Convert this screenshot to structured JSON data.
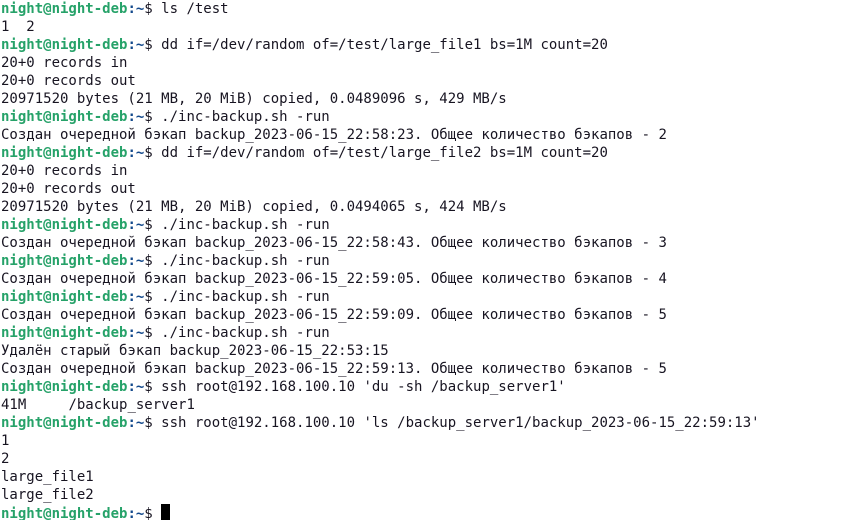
{
  "prompt": {
    "user_host": "night@night-deb",
    "path": ":~",
    "symbol": "$ "
  },
  "colors": {
    "user_host": "#26a269",
    "path": "#12488b",
    "text": "#171421",
    "background": "#ffffff"
  },
  "lines": [
    {
      "type": "cmd",
      "text": "ls /test"
    },
    {
      "type": "out",
      "text": "1  2"
    },
    {
      "type": "cmd",
      "text": "dd if=/dev/random of=/test/large_file1 bs=1M count=20"
    },
    {
      "type": "out",
      "text": "20+0 records in"
    },
    {
      "type": "out",
      "text": "20+0 records out"
    },
    {
      "type": "out",
      "text": "20971520 bytes (21 MB, 20 MiB) copied, 0.0489096 s, 429 MB/s"
    },
    {
      "type": "cmd",
      "text": "./inc-backup.sh -run"
    },
    {
      "type": "out",
      "text": "Создан очередной бэкап backup_2023-06-15_22:58:23. Общее количество бэкапов - 2"
    },
    {
      "type": "cmd",
      "text": "dd if=/dev/random of=/test/large_file2 bs=1M count=20"
    },
    {
      "type": "out",
      "text": "20+0 records in"
    },
    {
      "type": "out",
      "text": "20+0 records out"
    },
    {
      "type": "out",
      "text": "20971520 bytes (21 MB, 20 MiB) copied, 0.0494065 s, 424 MB/s"
    },
    {
      "type": "cmd",
      "text": "./inc-backup.sh -run"
    },
    {
      "type": "out",
      "text": "Создан очередной бэкап backup_2023-06-15_22:58:43. Общее количество бэкапов - 3"
    },
    {
      "type": "cmd",
      "text": "./inc-backup.sh -run"
    },
    {
      "type": "out",
      "text": "Создан очередной бэкап backup_2023-06-15_22:59:05. Общее количество бэкапов - 4"
    },
    {
      "type": "cmd",
      "text": "./inc-backup.sh -run"
    },
    {
      "type": "out",
      "text": "Создан очередной бэкап backup_2023-06-15_22:59:09. Общее количество бэкапов - 5"
    },
    {
      "type": "cmd",
      "text": "./inc-backup.sh -run"
    },
    {
      "type": "out",
      "text": "Удалён старый бэкап backup_2023-06-15_22:53:15"
    },
    {
      "type": "out",
      "text": "Создан очередной бэкап backup_2023-06-15_22:59:13. Общее количество бэкапов - 5"
    },
    {
      "type": "cmd",
      "text": "ssh root@192.168.100.10 'du -sh /backup_server1'"
    },
    {
      "type": "out",
      "text": "41M\t/backup_server1"
    },
    {
      "type": "cmd",
      "text": "ssh root@192.168.100.10 'ls /backup_server1/backup_2023-06-15_22:59:13'"
    },
    {
      "type": "out",
      "text": "1"
    },
    {
      "type": "out",
      "text": "2"
    },
    {
      "type": "out",
      "text": "large_file1"
    },
    {
      "type": "out",
      "text": "large_file2"
    },
    {
      "type": "input",
      "text": ""
    }
  ]
}
